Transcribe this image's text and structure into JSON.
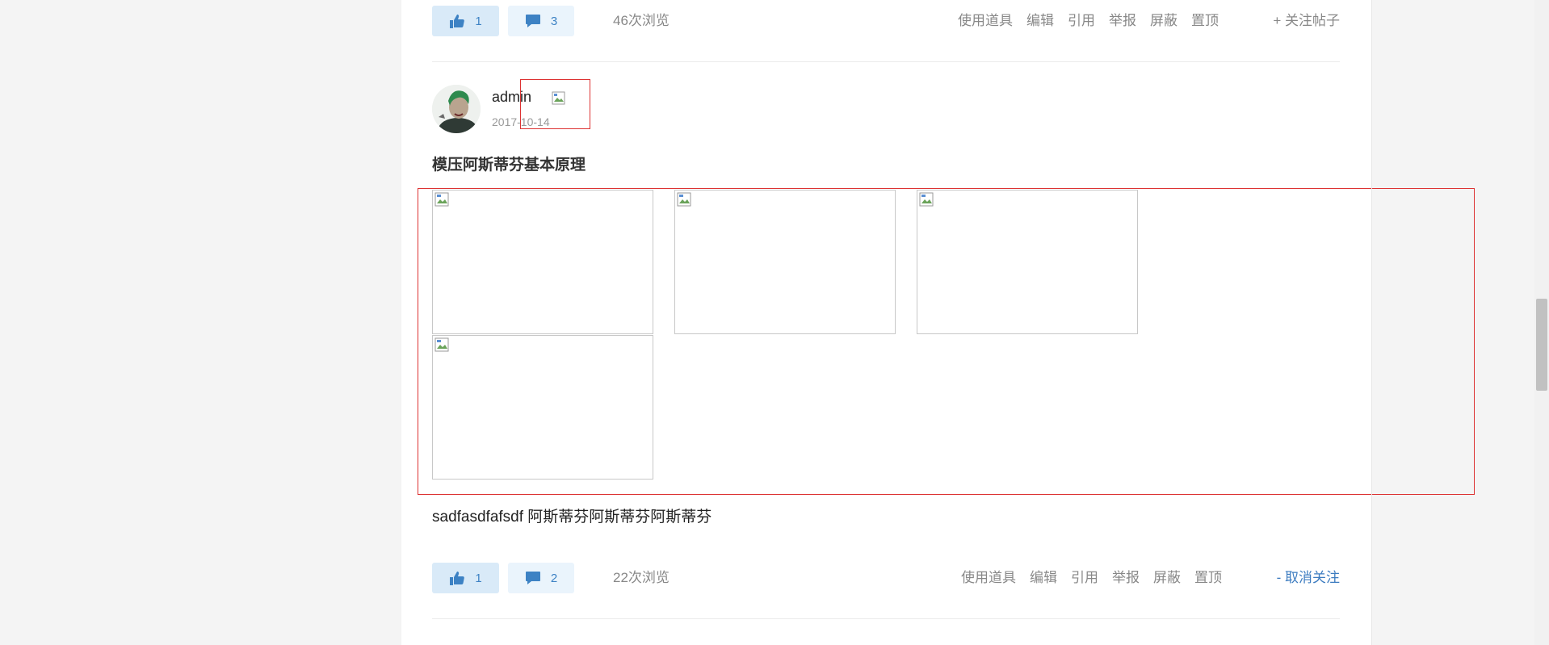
{
  "post_prev": {
    "likes": "1",
    "comments": "3",
    "views": "46次浏览",
    "tools": [
      "使用道具",
      "编辑",
      "引用",
      "举报",
      "屏蔽",
      "置顶"
    ],
    "follow": "+ 关注帖子"
  },
  "post": {
    "author": "admin",
    "date": "2017-10-14",
    "title": "模压阿斯蒂芬基本原理",
    "images": [
      "",
      "",
      "",
      ""
    ],
    "body": "sadfasdfafsdf 阿斯蒂芬阿斯蒂芬阿斯蒂芬",
    "likes": "1",
    "comments": "2",
    "views": "22次浏览",
    "tools": [
      "使用道具",
      "编辑",
      "引用",
      "举报",
      "屏蔽",
      "置顶"
    ],
    "follow": "- 取消关注"
  },
  "colors": {
    "accent": "#3d82c4",
    "highlight_border": "#dd3333",
    "muted_text": "#888888"
  },
  "icons": {
    "like": "thumbs-up-icon",
    "comment": "comment-bubble-icon",
    "broken_image": "broken-image-icon"
  }
}
